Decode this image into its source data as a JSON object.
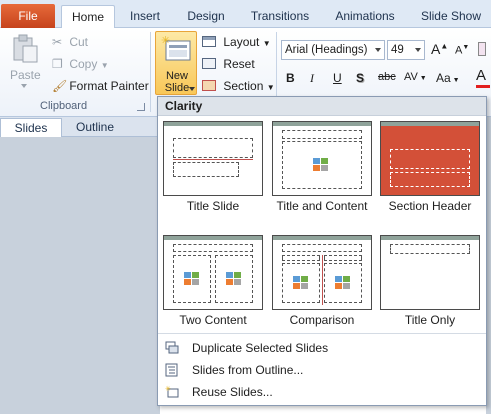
{
  "tabs": [
    {
      "label": "File"
    },
    {
      "label": "Home"
    },
    {
      "label": "Insert"
    },
    {
      "label": "Design"
    },
    {
      "label": "Transitions"
    },
    {
      "label": "Animations"
    },
    {
      "label": "Slide Show"
    }
  ],
  "clipboard": {
    "paste": "Paste",
    "cut": "Cut",
    "copy": "Copy",
    "format_painter": "Format Painter",
    "group_label": "Clipboard"
  },
  "slides_group": {
    "new_slide_line1": "New",
    "new_slide_line2": "Slide",
    "layout": "Layout",
    "reset": "Reset",
    "section": "Section"
  },
  "font": {
    "family": "Arial (Headings)",
    "size": "49",
    "grow": "A",
    "shrink": "A",
    "bold": "B",
    "italic": "I",
    "underline": "U",
    "shadow": "S",
    "strike": "abc",
    "spacing": "AV",
    "change_case": "Aa",
    "color": "A"
  },
  "pane": {
    "tab_slides": "Slides",
    "tab_outline": "Outline"
  },
  "gallery": {
    "header": "Clarity",
    "layouts": [
      {
        "label": "Title Slide"
      },
      {
        "label": "Title and Content"
      },
      {
        "label": "Section Header"
      },
      {
        "label": "Two Content"
      },
      {
        "label": "Comparison"
      },
      {
        "label": "Title Only"
      }
    ],
    "menu": [
      {
        "label": "Duplicate Selected Slides"
      },
      {
        "label": "Slides from Outline..."
      },
      {
        "label": "Reuse Slides..."
      }
    ]
  },
  "colors": {
    "file_tab": "#d6532a",
    "section_header_bg": "#d35038",
    "accent_highlight": "#f8c758",
    "font_color_bar": "#e21f1f"
  }
}
